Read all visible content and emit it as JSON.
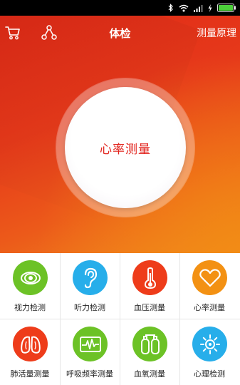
{
  "status_bar": {
    "icons": [
      "bluetooth-icon",
      "wifi-icon",
      "cellular-signal-icon",
      "charging-icon",
      "battery-icon"
    ],
    "battery_color": "#4ccf3a"
  },
  "header": {
    "title": "体检",
    "right_link": "测量原理",
    "left_icons": [
      "cart-icon",
      "share-icon"
    ]
  },
  "hero": {
    "button_label": "心率测量",
    "accent_color": "#e2241e"
  },
  "tiles": [
    {
      "label": "视力检测",
      "icon": "eye-icon",
      "color": "#6cc226"
    },
    {
      "label": "听力检测",
      "icon": "ear-icon",
      "color": "#27aeea"
    },
    {
      "label": "血压测量",
      "icon": "thermometer-icon",
      "color": "#ee3c1a"
    },
    {
      "label": "心率测量",
      "icon": "heart-icon",
      "color": "#f39113"
    },
    {
      "label": "肺活量测量",
      "icon": "lungs-icon",
      "color": "#ee3c1a"
    },
    {
      "label": "呼吸频率测量",
      "icon": "heartbeat-monitor-icon",
      "color": "#6cc226"
    },
    {
      "label": "血氧测量",
      "icon": "oxygen-tanks-icon",
      "color": "#6cc226"
    },
    {
      "label": "心理检测",
      "icon": "sun-gear-icon",
      "color": "#27aeea"
    }
  ]
}
